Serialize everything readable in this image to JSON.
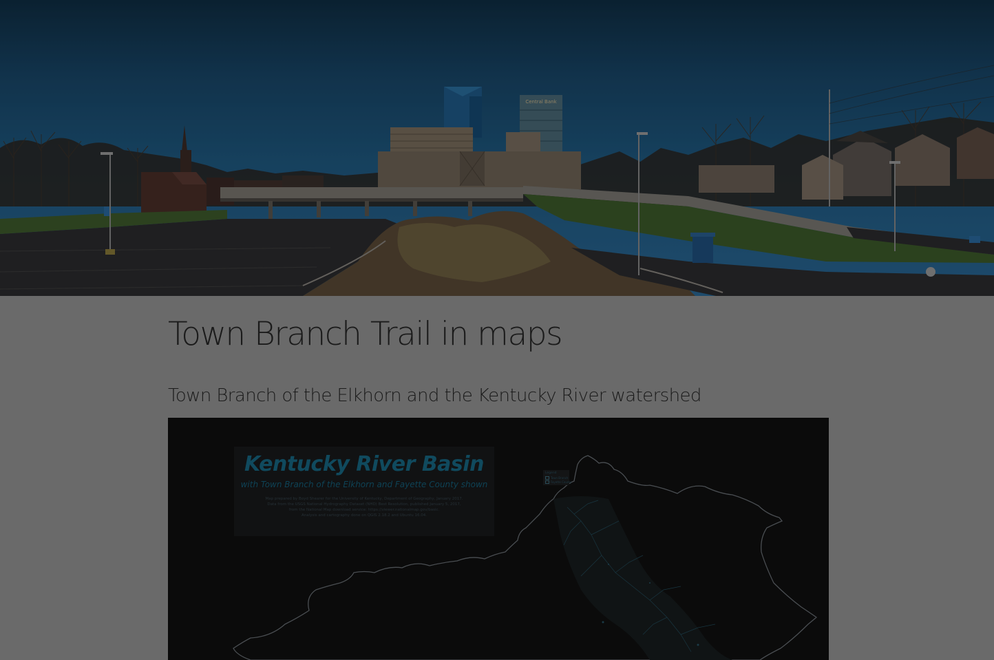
{
  "page": {
    "title": "Town Branch Trail in maps",
    "section_title": "Town Branch of the Elkhorn and the Kentucky River watershed"
  },
  "hero": {
    "building_sign": "Central Bank"
  },
  "map": {
    "title": "Kentucky River Basin",
    "subtitle": "with Town Branch of the Elkhorn and Fayette County shown",
    "credits": [
      "Map prepared by Boyd Shearer for the University of Kentucky, Department of Geography, January 2017.",
      "Data from the USGS National Hydrography Dataset (NHD) Best Resolution, published January 5, 2017,",
      "from the National Map download service: https://viewer.nationalmap.gov/basic.",
      "Analysis and cartography done on QGIS 2.18.2 and Ubuntu 16.04."
    ],
    "legend": {
      "title": "Legend",
      "items": [
        "Town Branch",
        "Fayette County"
      ]
    }
  },
  "colors": {
    "page_background": "#6a6a6a",
    "map_background": "#0b0b0b",
    "map_title": "#104a5e",
    "text": "#1b1b1b"
  }
}
